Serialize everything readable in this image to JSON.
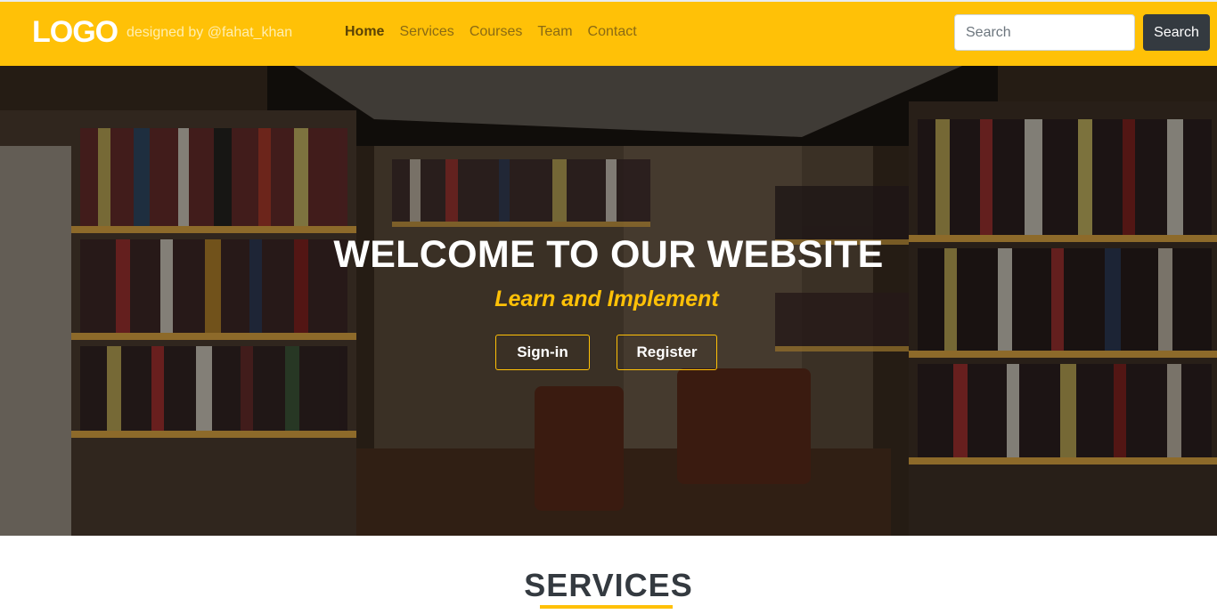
{
  "navbar": {
    "logo": "LOGO",
    "credit": "designed by @fahat_khan",
    "links": [
      "Home",
      "Services",
      "Courses",
      "Team",
      "Contact"
    ],
    "search_placeholder": "Search",
    "search_button": "Search"
  },
  "hero": {
    "title": "WELCOME TO OUR WEBSITE",
    "subtitle": "Learn and Implement",
    "signin_label": "Sign-in",
    "register_label": "Register"
  },
  "services": {
    "title": "SERVICES"
  },
  "colors": {
    "accent": "#ffc107",
    "dark": "#343a40"
  }
}
